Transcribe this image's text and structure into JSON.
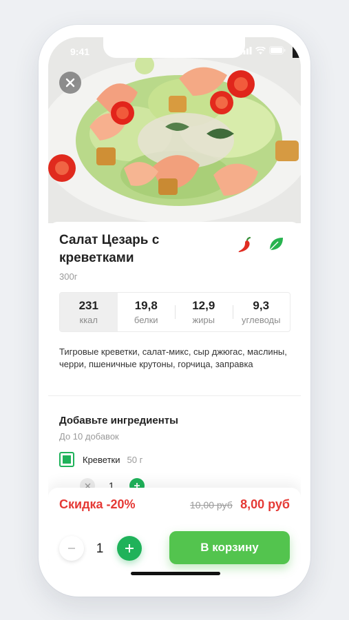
{
  "status": {
    "time": "9:41"
  },
  "product": {
    "title": "Салат Цезарь с креветками",
    "weight": "300г",
    "badges": [
      "chili-icon",
      "leaf-icon"
    ],
    "nutrition": [
      {
        "value": "231",
        "label": "ккал"
      },
      {
        "value": "19,8",
        "label": "белки"
      },
      {
        "value": "12,9",
        "label": "жиры"
      },
      {
        "value": "9,3",
        "label": "углеводы"
      }
    ],
    "description": "Тигровые креветки, салат-микс, сыр джюгас, маслины, черри, пшеничные крутоны, горчица, заправка"
  },
  "addons": {
    "title": "Добавьте ингредиенты",
    "subtitle": "До 10 добавок",
    "items": [
      {
        "name": "Креветки",
        "weight": "50 г",
        "checked": true,
        "quantity": "1"
      }
    ]
  },
  "footer": {
    "discount": "Скидка -20%",
    "old_price": "10,00 руб",
    "new_price": "8,00 руб",
    "quantity": "1",
    "cart_label": "В корзину"
  },
  "colors": {
    "accent_green": "#1fb25a",
    "cart_green": "#53c44e",
    "discount_red": "#e53935"
  }
}
